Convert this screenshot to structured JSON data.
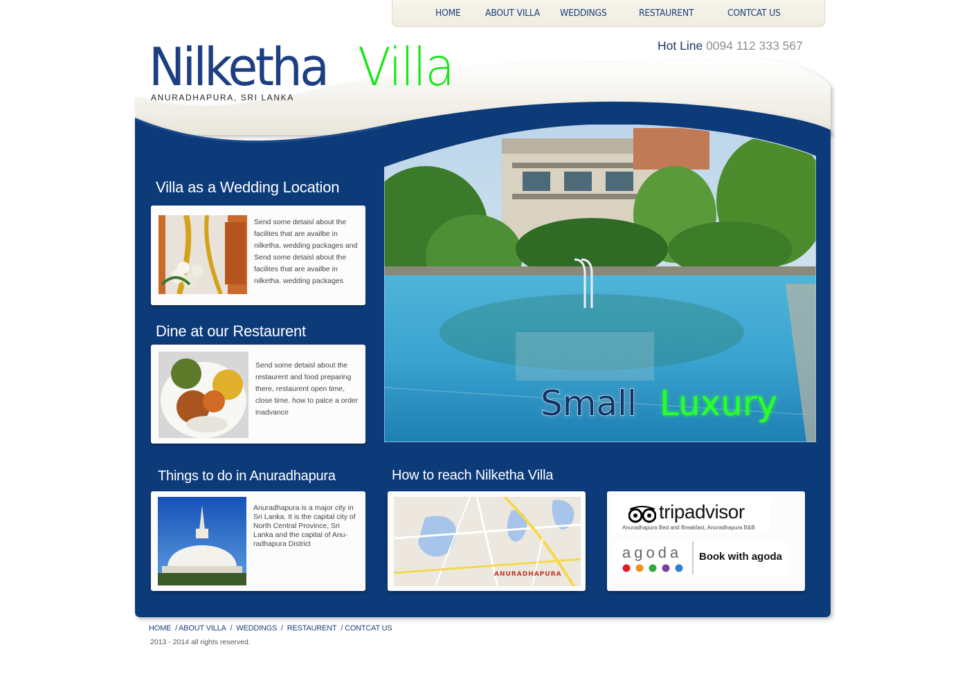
{
  "nav": {
    "items": [
      "HOME",
      "ABOUT VILLA",
      "WEDDINGS",
      "RESTAURENT",
      "CONTCAT US"
    ]
  },
  "logo": {
    "part1": "Nilketha",
    "part2": "Villa",
    "subtitle": "ANURADHAPURA, SRI LANKA"
  },
  "hotline": {
    "label": "Hot Line",
    "number": "0094 112 333 567"
  },
  "hero": {
    "tag_part1": "Small",
    "tag_part2": "Luxury"
  },
  "sections": {
    "wedding": {
      "title": "Villa as a Wedding Location",
      "text": "Send some detaisl about the facilites that are availbe in nilketha. wedding packages and Send some detaisl about the facilites that are availbe in nilketha. wedding packages"
    },
    "restaurant": {
      "title": "Dine at our Restaurent",
      "text": "Send some detaisl about the restaurent and food preparing there, restaurent open time, close time. how to palce a order inadvance"
    },
    "things": {
      "title": "Things to do in Anuradhapura",
      "text": "Anuradhapura  is a major city in Sri Lanka. It is the capital city of North Central Province, Sri Lanka and the capital of Anu-radhapura District"
    },
    "reach": {
      "title": "How to reach Nilketha Villa",
      "map_label": "ANURADHAPURA"
    }
  },
  "partners": {
    "tripadvisor": "tripadvisor",
    "tripadvisor_sub": "Anuradhapura Bed and Breakfast, Anuradhapura B&B",
    "agoda": "agoda",
    "agoda_cta": "Book with agoda"
  },
  "footer": {
    "links": [
      "HOME",
      "/ ABOUT VILLA",
      "/",
      "WEDDINGS",
      "/",
      "RESTAURENT",
      "/ CONTCAT US"
    ],
    "copyright": "2013 - 2014 all rights reserved."
  },
  "colors": {
    "panel_blue": "#083a7a",
    "logo_blue": "#1d3f82",
    "logo_green": "#17e617",
    "nav_text": "#1b3f78"
  }
}
